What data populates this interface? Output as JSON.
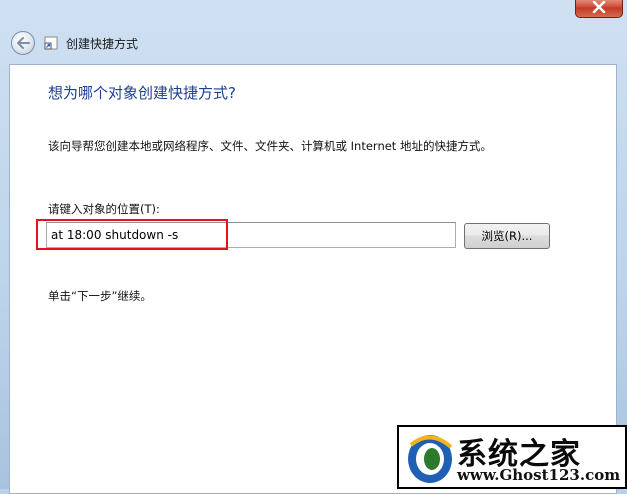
{
  "window": {
    "title": "创建快捷方式",
    "close_icon": "close-icon",
    "back_icon": "back-arrow-icon",
    "app_icon": "shortcut-icon"
  },
  "wizard": {
    "heading": "想为哪个对象创建快捷方式?",
    "description": "该向导帮您创建本地或网络程序、文件、文件夹、计算机或 Internet 地址的快捷方式。",
    "location_label": "请键入对象的位置(T):",
    "location_value": "at 18:00 shutdown -s",
    "browse_label": "浏览(R)...",
    "hint": "单击“下一步”继续。"
  },
  "watermark": {
    "title": "系统之家",
    "url": "www.Ghost123.com"
  },
  "colors": {
    "heading": "#1c3f96",
    "highlight": "#e8101c",
    "close_button": "#c13a24"
  }
}
